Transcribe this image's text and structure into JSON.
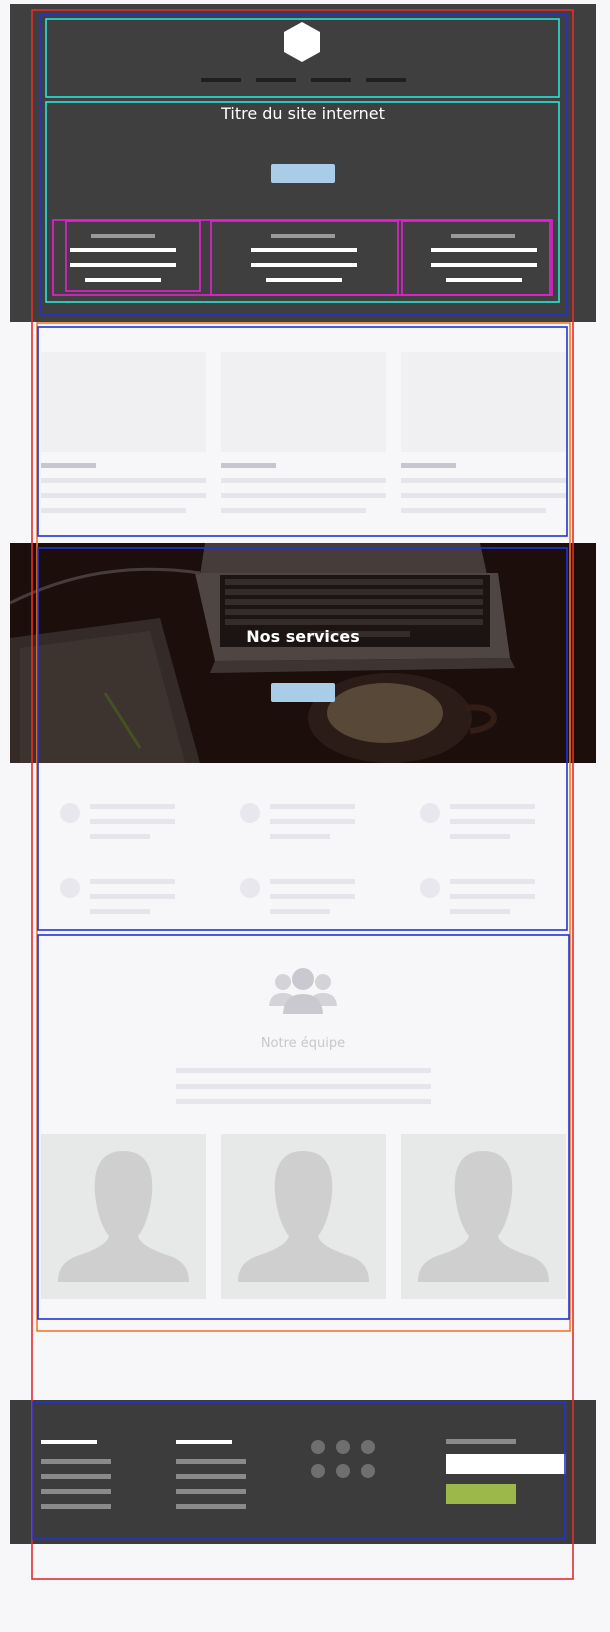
{
  "header": {
    "logo_icon": "hexagon-logo-icon",
    "nav_items": [
      "",
      "",
      "",
      ""
    ],
    "site_title": "Titre du site internet",
    "cta_label": "",
    "features": [
      {
        "title": "",
        "lines": [
          "",
          "",
          ""
        ]
      },
      {
        "title": "",
        "lines": [
          "",
          "",
          ""
        ]
      },
      {
        "title": "",
        "lines": [
          "",
          "",
          ""
        ]
      }
    ]
  },
  "cards": [
    {
      "title": "",
      "lines": [
        "",
        "",
        ""
      ]
    },
    {
      "title": "",
      "lines": [
        "",
        "",
        ""
      ]
    },
    {
      "title": "",
      "lines": [
        "",
        "",
        ""
      ]
    }
  ],
  "services": {
    "title": "Nos services",
    "cta_label": "",
    "items": [
      "",
      "",
      "",
      "",
      "",
      ""
    ]
  },
  "team": {
    "icon": "team-group-icon",
    "title": "Notre équipe",
    "members": [
      "",
      "",
      ""
    ]
  },
  "footer": {
    "columns": [
      "",
      ""
    ],
    "social_icons": [
      "social-icon",
      "social-icon",
      "social-icon",
      "social-icon",
      "social-icon",
      "social-icon"
    ],
    "newsletter_placeholder": "",
    "subscribe_label": ""
  },
  "colors": {
    "header_bg": "#3f3f3f",
    "footer_bg": "#3c3c3c",
    "button_blue": "#a9cce8",
    "button_green": "#9cb84a",
    "outline_red": "#e32d2d",
    "outline_blue": "#2133d6",
    "outline_cyan": "#28e5d8",
    "outline_magenta": "#e620d4",
    "outline_orange": "#f07a2a"
  }
}
